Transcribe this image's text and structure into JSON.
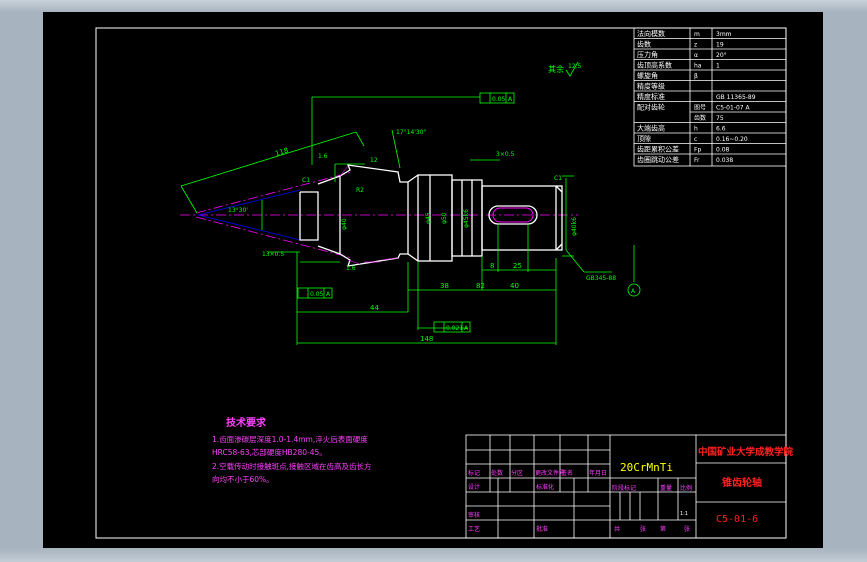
{
  "drawing": {
    "roughness_note": "其余",
    "roughness_value": "12.5",
    "tech_title": "技术要求",
    "tech_lines": [
      "1.齿面渗碳层深度1.0-1.4mm,淬火后表面硬度",
      "HRC58-63,芯部硬度HB280-45。",
      "2.空载传动时接触斑点,接触区域在齿高及齿长方",
      "向均不小于60%。"
    ],
    "dims": {
      "d118": "118",
      "d148": "148",
      "d82": "82",
      "d44": "44",
      "d38": "38",
      "d40": "40",
      "d8": "8",
      "d25": "25",
      "d13": "13×0.5",
      "d3x05": "3×0.5",
      "d1_6a": "1.6",
      "d1_6b": "1.6",
      "c1": "C1",
      "r2": "R2",
      "dia_a": "φ40",
      "dia_b": "φ45",
      "dia_c": "φ50",
      "dia_d": "φ45k6",
      "dia_e": "φ40k6",
      "ang1": "13°30'",
      "ang2": "17°14'30\"",
      "key": "GB345-88",
      "tol1": "0.05",
      "tol2": "0.05",
      "tol3": "0.021",
      "datum": "A",
      "dim_12": "12",
      "dim_c1b": "C1"
    },
    "params": [
      {
        "name": "法向模数",
        "sym": "m",
        "val": "3mm"
      },
      {
        "name": "齿数",
        "sym": "z",
        "val": "19"
      },
      {
        "name": "压力角",
        "sym": "α",
        "val": "20°"
      },
      {
        "name": "齿顶高系数",
        "sym": "ha",
        "val": "1"
      },
      {
        "name": "螺旋角",
        "sym": "β",
        "val": ""
      },
      {
        "name": "精度等级",
        "sym": "",
        "val": ""
      },
      {
        "name": "精度标准",
        "sym": "",
        "val": "GB 11365-89"
      },
      {
        "name": "配对齿轮",
        "sym": "图号",
        "val": "C5-01-07 A"
      },
      {
        "name": "",
        "sym": "齿数",
        "val": "75"
      },
      {
        "name": "大端齿高",
        "sym": "h",
        "val": "6.6"
      },
      {
        "name": "顶隙",
        "sym": "c",
        "val": "0.16~0.20"
      },
      {
        "name": "齿距累积公差",
        "sym": "Fp",
        "val": "0.08"
      },
      {
        "name": "齿圈跳动公差",
        "sym": "Fr",
        "val": "0.038"
      }
    ],
    "title_block": {
      "material": "20CrMnTi",
      "school": "中国矿业大学成教学院",
      "part_name": "锥齿轮轴",
      "drawing_no": "C5-01-6",
      "scale": "1:1",
      "row_labels": [
        "标记",
        "处数",
        "分区",
        "更改文件号",
        "签名",
        "年月日"
      ],
      "stage_labels": [
        "阶段标记",
        "重量",
        "比例"
      ],
      "sign_labels": [
        "设计",
        "标准化",
        "审核",
        "工艺",
        "批准"
      ],
      "sheet_labels": [
        "共",
        "张",
        "第",
        "张"
      ]
    }
  },
  "colors": {
    "background": "#000000",
    "frame": "#ffffff",
    "dimension": "#00ff00",
    "outline": "#ffffff",
    "centerline": "#ff00ff",
    "text_magenta": "#ff40ff",
    "red": "#ff2020",
    "yellow": "#ffff00",
    "hidden": "#0000ff"
  }
}
